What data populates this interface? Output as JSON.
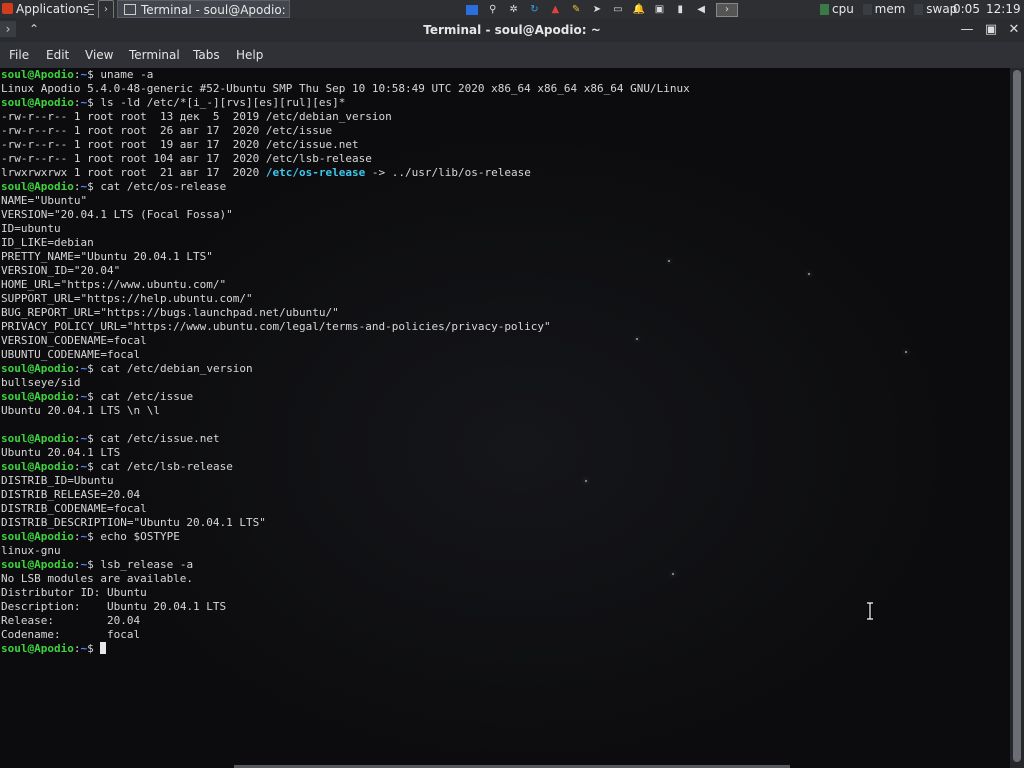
{
  "panel": {
    "apps_label": "Applications",
    "task_title": "Terminal - soul@Apodio: ~",
    "sys_icons": [
      "window-icon",
      "search-icon",
      "settings-icon",
      "refresh-icon",
      "triangle-icon",
      "pencil-icon",
      "arrow-icon",
      "drive-icon",
      "bell-icon",
      "network-icon",
      "battery-icon",
      "volume-icon",
      "terminal-icon"
    ],
    "monitors": {
      "cpu": "cpu",
      "mem": "mem",
      "swap": "swap"
    },
    "battery_time": "0:05",
    "clock": "12:19"
  },
  "window": {
    "title": "Terminal - soul@Apodio: ~",
    "menu": {
      "file": "File",
      "edit": "Edit",
      "view": "View",
      "terminal": "Terminal",
      "tabs": "Tabs",
      "help": "Help"
    }
  },
  "colors": {
    "prompt_user": "#3ed33e",
    "prompt_dir": "#4a8cff",
    "symlink": "#3fc7ee",
    "text": "#d7d7d7"
  },
  "terminal": {
    "lines": [
      {
        "type": "prompt",
        "user": "soul@Apodio",
        "sep": ":",
        "dir": "~",
        "sym": "$ ",
        "cmd": "uname -a"
      },
      {
        "type": "out",
        "text": "Linux Apodio 5.4.0-48-generic #52-Ubuntu SMP Thu Sep 10 10:58:49 UTC 2020 x86_64 x86_64 x86_64 GNU/Linux"
      },
      {
        "type": "prompt",
        "user": "soul@Apodio",
        "sep": ":",
        "dir": "~",
        "sym": "$ ",
        "cmd": "ls -ld /etc/*[i_-][rvs][es][rul][es]*"
      },
      {
        "type": "out",
        "text": "-rw-r--r-- 1 root root  13 дек  5  2019 /etc/debian_version"
      },
      {
        "type": "out",
        "text": "-rw-r--r-- 1 root root  26 авг 17  2020 /etc/issue"
      },
      {
        "type": "out",
        "text": "-rw-r--r-- 1 root root  19 авг 17  2020 /etc/issue.net"
      },
      {
        "type": "out",
        "text": "-rw-r--r-- 1 root root 104 авг 17  2020 /etc/lsb-release"
      },
      {
        "type": "link",
        "pre": "lrwxrwxrwx 1 root root  21 авг 17  2020 ",
        "name": "/etc/os-release",
        "post": " -> ../usr/lib/os-release"
      },
      {
        "type": "prompt",
        "user": "soul@Apodio",
        "sep": ":",
        "dir": "~",
        "sym": "$ ",
        "cmd": "cat /etc/os-release"
      },
      {
        "type": "out",
        "text": "NAME=\"Ubuntu\""
      },
      {
        "type": "out",
        "text": "VERSION=\"20.04.1 LTS (Focal Fossa)\""
      },
      {
        "type": "out",
        "text": "ID=ubuntu"
      },
      {
        "type": "out",
        "text": "ID_LIKE=debian"
      },
      {
        "type": "out",
        "text": "PRETTY_NAME=\"Ubuntu 20.04.1 LTS\""
      },
      {
        "type": "out",
        "text": "VERSION_ID=\"20.04\""
      },
      {
        "type": "out",
        "text": "HOME_URL=\"https://www.ubuntu.com/\""
      },
      {
        "type": "out",
        "text": "SUPPORT_URL=\"https://help.ubuntu.com/\""
      },
      {
        "type": "out",
        "text": "BUG_REPORT_URL=\"https://bugs.launchpad.net/ubuntu/\""
      },
      {
        "type": "out",
        "text": "PRIVACY_POLICY_URL=\"https://www.ubuntu.com/legal/terms-and-policies/privacy-policy\""
      },
      {
        "type": "out",
        "text": "VERSION_CODENAME=focal"
      },
      {
        "type": "out",
        "text": "UBUNTU_CODENAME=focal"
      },
      {
        "type": "prompt",
        "user": "soul@Apodio",
        "sep": ":",
        "dir": "~",
        "sym": "$ ",
        "cmd": "cat /etc/debian_version"
      },
      {
        "type": "out",
        "text": "bullseye/sid"
      },
      {
        "type": "prompt",
        "user": "soul@Apodio",
        "sep": ":",
        "dir": "~",
        "sym": "$ ",
        "cmd": "cat /etc/issue"
      },
      {
        "type": "out",
        "text": "Ubuntu 20.04.1 LTS \\n \\l"
      },
      {
        "type": "out",
        "text": ""
      },
      {
        "type": "prompt",
        "user": "soul@Apodio",
        "sep": ":",
        "dir": "~",
        "sym": "$ ",
        "cmd": "cat /etc/issue.net"
      },
      {
        "type": "out",
        "text": "Ubuntu 20.04.1 LTS"
      },
      {
        "type": "prompt",
        "user": "soul@Apodio",
        "sep": ":",
        "dir": "~",
        "sym": "$ ",
        "cmd": "cat /etc/lsb-release"
      },
      {
        "type": "out",
        "text": "DISTRIB_ID=Ubuntu"
      },
      {
        "type": "out",
        "text": "DISTRIB_RELEASE=20.04"
      },
      {
        "type": "out",
        "text": "DISTRIB_CODENAME=focal"
      },
      {
        "type": "out",
        "text": "DISTRIB_DESCRIPTION=\"Ubuntu 20.04.1 LTS\""
      },
      {
        "type": "prompt",
        "user": "soul@Apodio",
        "sep": ":",
        "dir": "~",
        "sym": "$ ",
        "cmd": "echo $OSTYPE"
      },
      {
        "type": "out",
        "text": "linux-gnu"
      },
      {
        "type": "prompt",
        "user": "soul@Apodio",
        "sep": ":",
        "dir": "~",
        "sym": "$ ",
        "cmd": "lsb_release -a"
      },
      {
        "type": "out",
        "text": "No LSB modules are available."
      },
      {
        "type": "out",
        "text": "Distributor ID:\tUbuntu"
      },
      {
        "type": "out",
        "text": "Description:\tUbuntu 20.04.1 LTS"
      },
      {
        "type": "out",
        "text": "Release:\t20.04"
      },
      {
        "type": "out",
        "text": "Codename:\tfocal"
      },
      {
        "type": "prompt",
        "user": "soul@Apodio",
        "sep": ":",
        "dir": "~",
        "sym": "$ ",
        "cmd": "",
        "cursor": true
      }
    ]
  }
}
